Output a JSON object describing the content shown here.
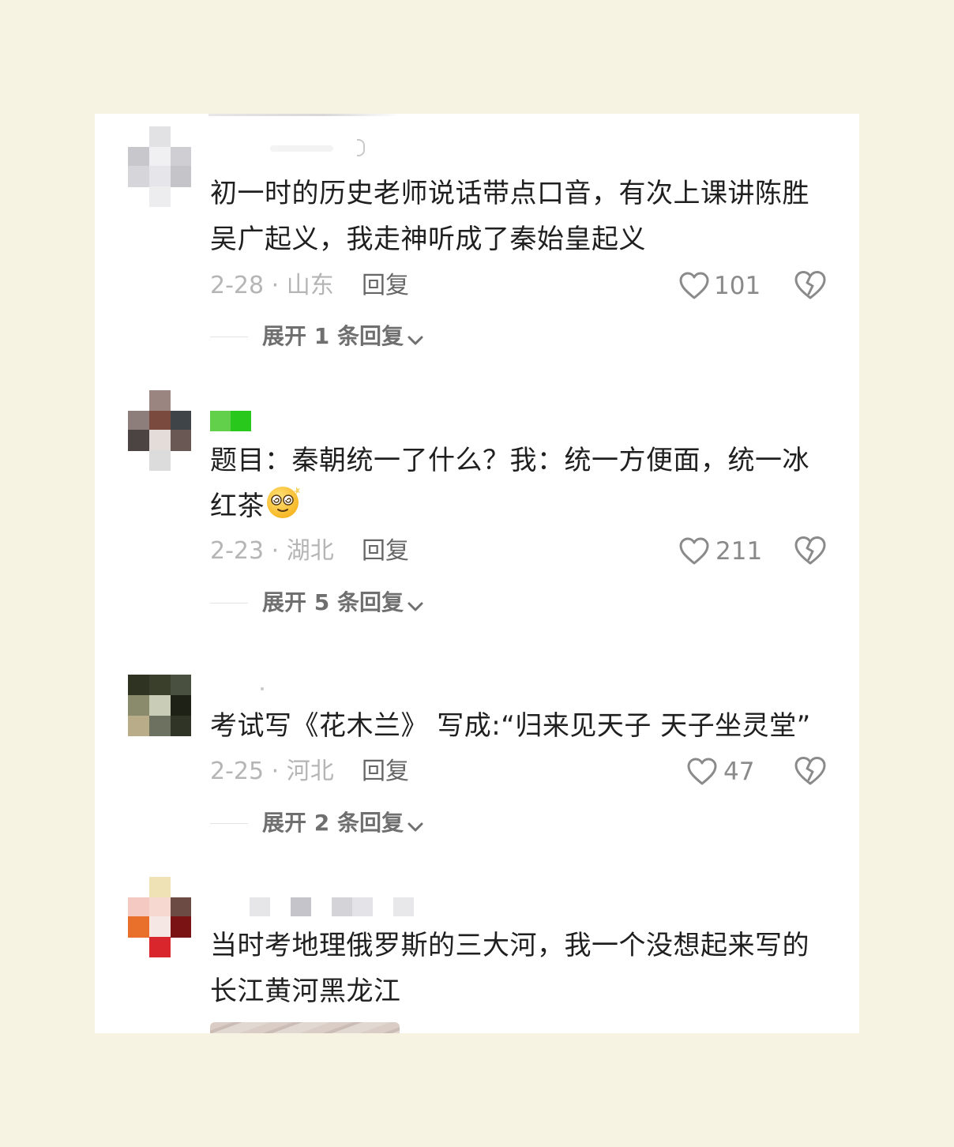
{
  "comments": [
    {
      "text": "初一时的历史老师说话带点口音，有次上课讲陈胜吴广起义，我走神听成了秦始皇起义",
      "time": "2-28 · 山东",
      "reply": "回复",
      "likes": "101",
      "expand": "展开 1 条回复"
    },
    {
      "text": "题目：秦朝统一了什么？我：统一方便面，统一冰红茶",
      "emoji": "dizzy-face-emoji",
      "time": "2-23 · 湖北",
      "reply": "回复",
      "likes": "211",
      "expand": "展开 5 条回复"
    },
    {
      "text": "考试写《花木兰》 写成:“归来见天子 天子坐灵堂”",
      "time": "2-25 · 河北",
      "reply": "回复",
      "likes": "47",
      "expand": "展开 2 条回复"
    },
    {
      "text": "当时考地理俄罗斯的三大河，我一个没想起来写的长江黄河黑龙江"
    }
  ],
  "icons": {
    "like": "heart-outline-icon",
    "dislike": "broken-heart-icon",
    "expand": "chevron-down-icon"
  },
  "colors": {
    "page_background": "#f6f3e3",
    "card_background": "#ffffff",
    "text": "#1f1f1f",
    "meta": "#b5b5b5",
    "reply": "#666666"
  }
}
